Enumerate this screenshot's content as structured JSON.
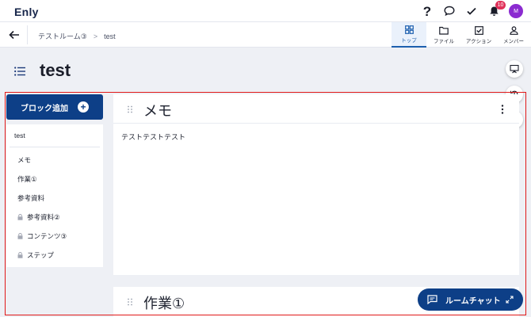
{
  "app": {
    "logo": "Enly"
  },
  "topbar": {
    "icons": [
      "help-icon",
      "chat-bubble-icon",
      "check-icon",
      "bell-icon"
    ],
    "notification_count": "10",
    "avatar_initial": "M"
  },
  "subbar": {
    "breadcrumbs": [
      "テストルーム③",
      "test"
    ],
    "separator": ">",
    "tabs": [
      {
        "label": "トップ",
        "icon": "grid-icon",
        "active": true
      },
      {
        "label": "ファイル",
        "icon": "folder-icon",
        "active": false
      },
      {
        "label": "アクション",
        "icon": "checkbox-icon",
        "active": false
      },
      {
        "label": "メンバー",
        "icon": "person-icon",
        "active": false
      }
    ]
  },
  "page": {
    "title": "test"
  },
  "sidebar": {
    "add_block_label": "ブロック追加",
    "header": "test",
    "items": [
      {
        "label": "メモ",
        "locked": false
      },
      {
        "label": "作業①",
        "locked": false
      },
      {
        "label": "参考資料",
        "locked": false
      },
      {
        "label": "参考資料②",
        "locked": true
      },
      {
        "label": "コンテンツ③",
        "locked": true
      },
      {
        "label": "ステップ",
        "locked": true
      }
    ]
  },
  "blocks": [
    {
      "title": "メモ",
      "content": "テストテストテスト"
    },
    {
      "title": "作業①",
      "content": ""
    }
  ],
  "chat": {
    "label": "ルームチャット"
  },
  "colors": {
    "primary": "#0d3f87",
    "accent_tab": "#1d5fae",
    "badge": "#e0315a",
    "avatar": "#8b2bd0",
    "highlight_outline": "#e01818"
  }
}
